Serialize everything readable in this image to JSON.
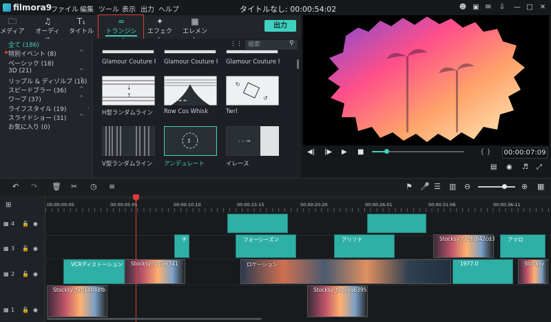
{
  "app": {
    "name": "filmora9",
    "title": "タイトルなし: 00:00:54:02"
  },
  "menu": [
    "ファイル",
    "編集",
    "ツール",
    "表示",
    "出力",
    "ヘルプ"
  ],
  "tabs": [
    {
      "label": "メディア",
      "icon": "folder-icon"
    },
    {
      "label": "オーディオ",
      "icon": "music-note-icon"
    },
    {
      "label": "タイトル",
      "icon": "text-icon"
    },
    {
      "label": "トランジション",
      "icon": "transition-icon",
      "active": true
    },
    {
      "label": "エフェクト",
      "icon": "effects-icon"
    },
    {
      "label": "エレメント",
      "icon": "image-icon"
    }
  ],
  "export_label": "出力",
  "categories": [
    {
      "label": "全て (186)",
      "selected": true
    },
    {
      "label": "特別イベント (8)",
      "arrow": "^"
    },
    {
      "label": "ベーシック (18)"
    },
    {
      "label": "3D (21)",
      "arrow": "^"
    },
    {
      "label": "リップル & ディゾルブ (16)",
      "arrow": "^"
    },
    {
      "label": "スピードブラー (36)",
      "arrow": "^"
    },
    {
      "label": "ワープ (37)",
      "arrow": "^"
    },
    {
      "label": "ライフスタイル (19)"
    },
    {
      "label": "スライドショー (31)",
      "arrow": "^"
    },
    {
      "label": "お気に入り (0)"
    }
  ],
  "search": {
    "placeholder": "検索"
  },
  "transitions": [
    {
      "label": "Glamour Couture P..."
    },
    {
      "label": "Glamour Couture P..."
    },
    {
      "label": "Glamour Couture P..."
    },
    {
      "label": "H型ランダムライン"
    },
    {
      "label": "Row Cos Whisk"
    },
    {
      "label": "Twrl"
    },
    {
      "label": "V型ランダムライン"
    },
    {
      "label": "アンデュレート",
      "selected": true
    },
    {
      "label": "イレース"
    }
  ],
  "preview": {
    "timecode": "00:00:07:09",
    "brace": "{ }"
  },
  "ruler": [
    "00:00:00:00",
    "00:00:05:05",
    "00:00:10:10",
    "00:00:15:15",
    "00:00:20:20",
    "00:00:26:01",
    "00:00:31:06",
    "00:00:36:11"
  ],
  "tracks": [
    {
      "name": "4",
      "clips": [
        {
          "label": ""
        },
        {
          "label": ""
        }
      ]
    },
    {
      "name": "3",
      "clips": [
        {
          "label": "チ"
        },
        {
          "label": "フォーシーズン"
        },
        {
          "label": "アリソナ"
        },
        {
          "label": "Stocksy_txpfd842cd3"
        },
        {
          "label": "アマロ"
        }
      ]
    },
    {
      "name": "2",
      "clips": [
        {
          "label": "VCRディストーション"
        },
        {
          "label": "Stocksy_txpa6341"
        },
        {
          "label": "ロケーション"
        },
        {
          "label": "1977.0"
        },
        {
          "label": "Stocksy"
        }
      ]
    },
    {
      "name": "1",
      "clips": [
        {
          "label": "Stocksy_txp14848fb"
        },
        {
          "label": "Stocksy_txpcea6395"
        }
      ]
    }
  ]
}
